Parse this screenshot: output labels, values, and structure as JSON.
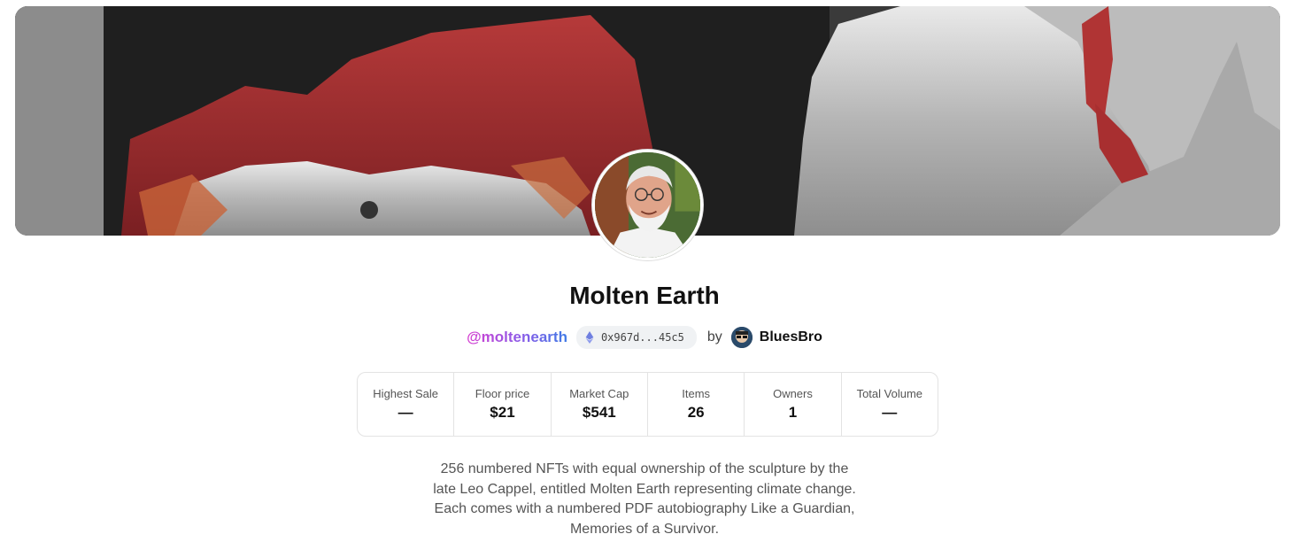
{
  "collection": {
    "title": "Molten Earth",
    "handle": "@moltenearth",
    "address": "0x967d...45c5",
    "by_label": "by",
    "creator": "BluesBro"
  },
  "stats": [
    {
      "label": "Highest Sale",
      "value": "—"
    },
    {
      "label": "Floor price",
      "value": "$21"
    },
    {
      "label": "Market Cap",
      "value": "$541"
    },
    {
      "label": "Items",
      "value": "26"
    },
    {
      "label": "Owners",
      "value": "1"
    },
    {
      "label": "Total Volume",
      "value": "—"
    }
  ],
  "description": "256 numbered NFTs with equal ownership of the sculpture by the late Leo Cappel, entitled Molten Earth representing climate change. Each comes with a numbered PDF autobiography Like a Guardian, Memories of a Survivor.",
  "icons": {
    "chain": "ethereum-icon"
  },
  "colors": {
    "handle_gradient_start": "#d63fd1",
    "handle_gradient_end": "#3f7be6",
    "pill_background": "#f0f2f4",
    "border": "#e3e3e3"
  }
}
